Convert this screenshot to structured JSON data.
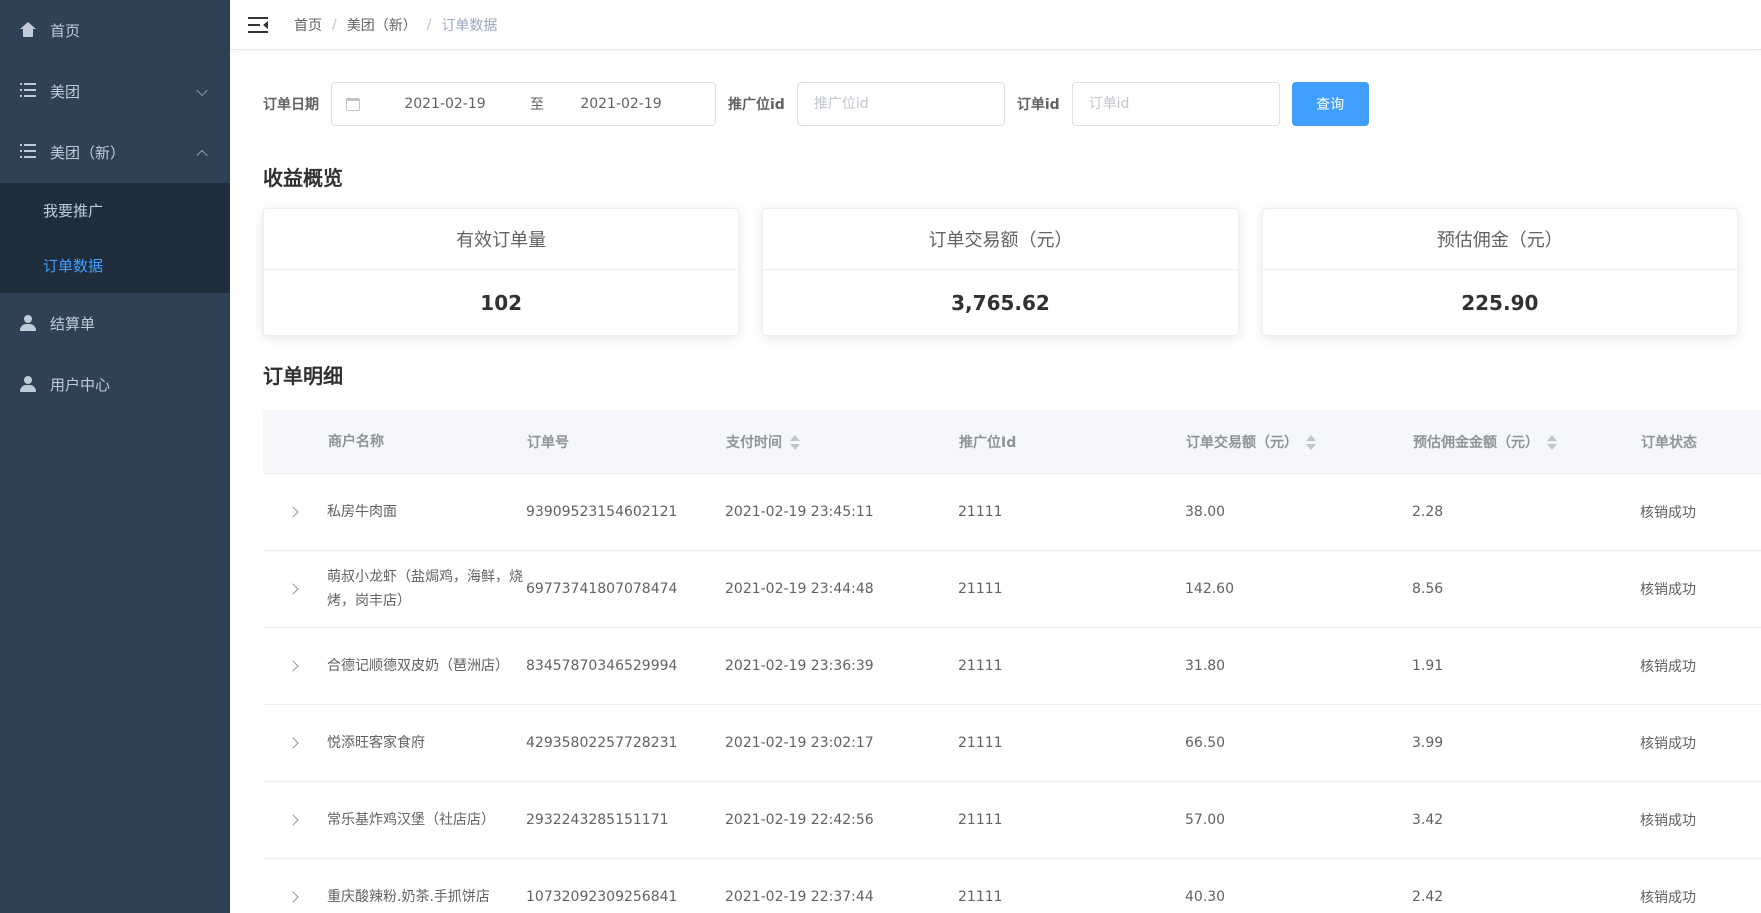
{
  "sidebar": {
    "items": [
      {
        "label": "首页"
      },
      {
        "label": "美团"
      },
      {
        "label": "美团（新）"
      },
      {
        "label": "结算单"
      },
      {
        "label": "用户中心"
      }
    ],
    "sub_items": [
      {
        "label": "我要推广"
      },
      {
        "label": "订单数据"
      }
    ]
  },
  "breadcrumb": {
    "home": "首页",
    "section": "美团（新）",
    "current": "订单数据",
    "sep": "/"
  },
  "filter": {
    "date_label": "订单日期",
    "date_start": "2021-02-19",
    "date_sep": "至",
    "date_end": "2021-02-19",
    "position_label": "推广位id",
    "position_placeholder": "推广位id",
    "order_label": "订单id",
    "order_placeholder": "订单id",
    "query_button": "查询"
  },
  "overview": {
    "title": "收益概览",
    "cards": [
      {
        "label": "有效订单量",
        "value": "102"
      },
      {
        "label": "订单交易额（元）",
        "value": "3,765.62"
      },
      {
        "label": "预估佣金（元）",
        "value": "225.90"
      }
    ]
  },
  "details": {
    "title": "订单明细",
    "columns": [
      "商户名称",
      "订单号",
      "支付时间",
      "推广位Id",
      "订单交易额（元）",
      "预估佣金金额（元）",
      "订单状态"
    ],
    "rows": [
      {
        "merchant": "私房牛肉面",
        "order_no": "93909523154602121",
        "pay_time": "2021-02-19 23:45:11",
        "position_id": "21111",
        "amount": "38.00",
        "commission": "2.28",
        "status": "核销成功"
      },
      {
        "merchant": "萌叔小龙虾（盐焗鸡，海鲜，烧烤，岗丰店）",
        "order_no": "69773741807078474",
        "pay_time": "2021-02-19 23:44:48",
        "position_id": "21111",
        "amount": "142.60",
        "commission": "8.56",
        "status": "核销成功"
      },
      {
        "merchant": "合德记顺德双皮奶（琶洲店）",
        "order_no": "83457870346529994",
        "pay_time": "2021-02-19 23:36:39",
        "position_id": "21111",
        "amount": "31.80",
        "commission": "1.91",
        "status": "核销成功"
      },
      {
        "merchant": "悦添旺客家食府",
        "order_no": "42935802257728231",
        "pay_time": "2021-02-19 23:02:17",
        "position_id": "21111",
        "amount": "66.50",
        "commission": "3.99",
        "status": "核销成功"
      },
      {
        "merchant": "常乐基炸鸡汉堡（社店店）",
        "order_no": "2932243285151171",
        "pay_time": "2021-02-19 22:42:56",
        "position_id": "21111",
        "amount": "57.00",
        "commission": "3.42",
        "status": "核销成功"
      },
      {
        "merchant": "重庆酸辣粉.奶茶.手抓饼店",
        "order_no": "10732092309256841",
        "pay_time": "2021-02-19 22:37:44",
        "position_id": "21111",
        "amount": "40.30",
        "commission": "2.42",
        "status": "核销成功"
      }
    ]
  },
  "colors": {
    "sidebar_bg": "#304156",
    "submenu_bg": "#1f2d3d",
    "accent": "#409eff"
  }
}
